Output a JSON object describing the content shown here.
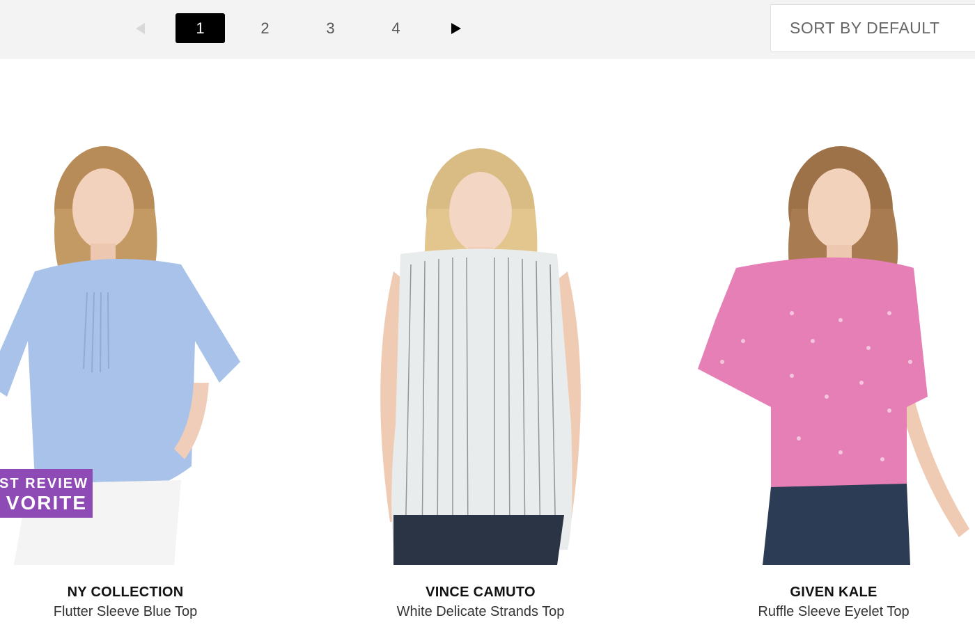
{
  "pagination": {
    "prev_icon": "triangle-left-icon",
    "next_icon": "triangle-right-icon",
    "pages": [
      "1",
      "2",
      "3",
      "4"
    ],
    "current": "1"
  },
  "sort": {
    "label": "SORT BY DEFAULT"
  },
  "badge": {
    "line1": "ST REVIEW",
    "line2": "VORITE",
    "color": "#8e4bb5"
  },
  "products": [
    {
      "brand": "NY COLLECTION",
      "name": "Flutter Sleeve Blue Top",
      "color": "#a9c2ea"
    },
    {
      "brand": "VINCE CAMUTO",
      "name": "White Delicate Strands Top",
      "color": "#e9ecec"
    },
    {
      "brand": "GIVEN KALE",
      "name": "Ruffle Sleeve Eyelet Top",
      "color": "#e77fb7"
    }
  ]
}
